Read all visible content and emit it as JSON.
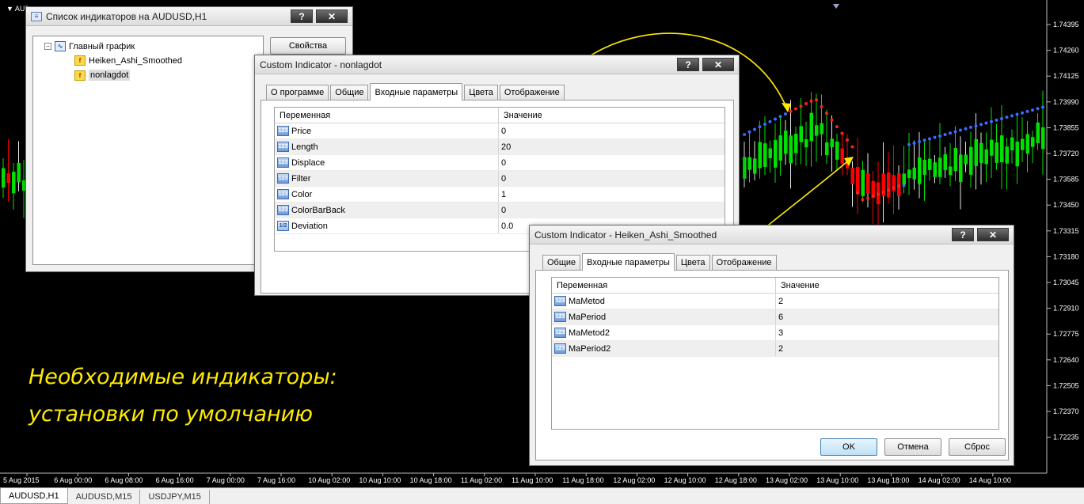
{
  "chart": {
    "symbol_label": "AUDUSD,H1",
    "symbol_short": "AUD",
    "price_ticks": [
      "1.74395",
      "1.74260",
      "1.74125",
      "1.73990",
      "1.73855",
      "1.73720",
      "1.73585",
      "1.73450",
      "1.73315",
      "1.73180",
      "1.73045",
      "1.72910",
      "1.72775",
      "1.72640",
      "1.72505",
      "1.72370",
      "1.72235"
    ],
    "time_ticks": [
      "5 Aug 2015",
      "6 Aug 00:00",
      "6 Aug 08:00",
      "6 Aug 16:00",
      "7 Aug 00:00",
      "7 Aug 16:00",
      "10 Aug 02:00",
      "10 Aug 10:00",
      "10 Aug 18:00",
      "11 Aug 02:00",
      "11 Aug 10:00",
      "11 Aug 18:00",
      "12 Aug 02:00",
      "12 Aug 10:00",
      "12 Aug 18:00",
      "13 Aug 02:00",
      "13 Aug 10:00",
      "13 Aug 18:00",
      "14 Aug 02:00",
      "14 Aug 10:00"
    ],
    "colors": {
      "bull": "#00e000",
      "bear": "#ff0000",
      "neutral": "#e8e8e8",
      "dot_up": "#3a6cff",
      "dot_down": "#ff2020",
      "annotation": "#ffea00"
    }
  },
  "list_window": {
    "title": "Список индикаторов на AUDUSD,H1",
    "help_btn": "?",
    "close_btn": "✕",
    "tree_root": "Главный график",
    "tree_root_toggle": "−",
    "items": [
      "Heiken_Ashi_Smoothed",
      "nonlagdot"
    ],
    "properties_btn": "Свойства"
  },
  "nonlagdot_window": {
    "title": "Custom Indicator - nonlagdot",
    "help_btn": "?",
    "close_btn": "✕",
    "tabs": [
      "О программе",
      "Общие",
      "Входные параметры",
      "Цвета",
      "Отображение"
    ],
    "active_tab": 2,
    "col_variable": "Переменная",
    "col_value": "Значение",
    "params": [
      {
        "name": "Price",
        "value": "0",
        "type": "123"
      },
      {
        "name": "Length",
        "value": "20",
        "type": "123"
      },
      {
        "name": "Displace",
        "value": "0",
        "type": "123"
      },
      {
        "name": "Filter",
        "value": "0",
        "type": "123"
      },
      {
        "name": "Color",
        "value": "1",
        "type": "123"
      },
      {
        "name": "ColorBarBack",
        "value": "0",
        "type": "123"
      },
      {
        "name": "Deviation",
        "value": "0.0",
        "type": "1/2"
      }
    ]
  },
  "heiken_window": {
    "title": "Custom Indicator - Heiken_Ashi_Smoothed",
    "help_btn": "?",
    "close_btn": "✕",
    "tabs": [
      "Общие",
      "Входные параметры",
      "Цвета",
      "Отображение"
    ],
    "active_tab": 1,
    "col_variable": "Переменная",
    "col_value": "Значение",
    "params": [
      {
        "name": "MaMetod",
        "value": "2",
        "type": "123"
      },
      {
        "name": "MaPeriod",
        "value": "6",
        "type": "123"
      },
      {
        "name": "MaMetod2",
        "value": "3",
        "type": "123"
      },
      {
        "name": "MaPeriod2",
        "value": "2",
        "type": "123"
      }
    ],
    "ok_btn": "OK",
    "cancel_btn": "Отмена",
    "reset_btn": "Сброс"
  },
  "annotation": {
    "line1": "Необходимые индикаторы:",
    "line2": "установки по умолчанию"
  },
  "taskbar": {
    "tabs": [
      "AUDUSD,H1",
      "AUDUSD,M15",
      "USDJPY,M15"
    ],
    "active": 0
  }
}
